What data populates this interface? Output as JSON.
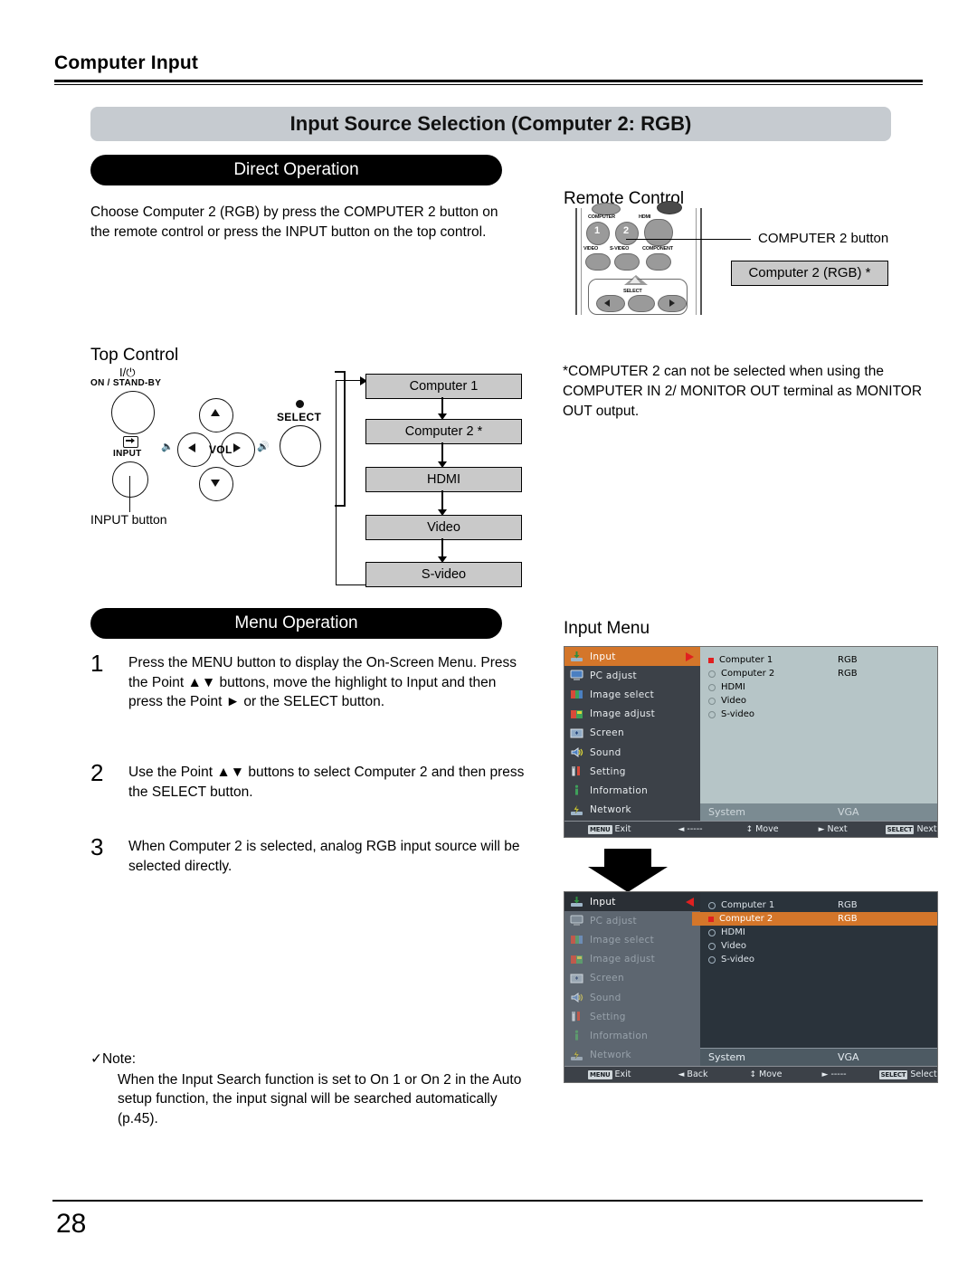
{
  "header": {
    "running_title": "Computer Input",
    "section_title": "Input Source Selection (Computer 2: RGB)"
  },
  "direct_operation": {
    "bar_label": "Direct Operation",
    "paragraph": "Choose Computer 2 (RGB) by press the COMPUTER 2 button on the remote control or press the INPUT button on the top control."
  },
  "remote": {
    "heading": "Remote Control",
    "callout": "COMPUTER 2 button",
    "highlight_box": "Computer 2 (RGB)  *",
    "buttons": {
      "computer": "COMPUTER",
      "hdmi": "HDMI",
      "one": "1",
      "two": "2",
      "video": "VIDEO",
      "svideo": "S-VIDEO",
      "component": "COMPONENT",
      "select": "SELECT"
    }
  },
  "footnote_star": "*COMPUTER 2 can not be selected when using the COMPUTER IN 2/ MONITOR OUT terminal as MONITOR OUT output.",
  "top_control": {
    "heading": "Top Control",
    "power_symbol": "I/⏻",
    "power_label": "ON / STAND-BY",
    "input_label": "INPUT",
    "vol_label": "VOL",
    "select_label": "SELECT",
    "callout": "INPUT button"
  },
  "flow_chart": {
    "items": [
      "Computer 1",
      "Computer 2 *",
      "HDMI",
      "Video",
      "S-video"
    ]
  },
  "menu_operation": {
    "bar_label": "Menu Operation",
    "steps": [
      {
        "num": "1",
        "text": "Press the MENU button to display the On-Screen Menu. Press the Point ▲▼ buttons, move the highlight to Input  and then press the Point ► or the SELECT button."
      },
      {
        "num": "2",
        "text": "Use the Point ▲▼ buttons to select Computer 2 and then press the SELECT button."
      },
      {
        "num": "3",
        "text": "When Computer 2 is selected, analog RGB input source will be selected directly."
      }
    ]
  },
  "note": {
    "heading": "✓Note:",
    "body": "When the Input Search function is set to On 1 or On 2 in the Auto setup function, the input signal will be searched automatically (p.45)."
  },
  "input_menu": {
    "heading": "Input Menu",
    "sidebar": [
      {
        "label": "Input",
        "icon": "input-icon"
      },
      {
        "label": "PC adjust",
        "icon": "monitor-icon"
      },
      {
        "label": "Image select",
        "icon": "image-select-icon"
      },
      {
        "label": "Image adjust",
        "icon": "image-adjust-icon"
      },
      {
        "label": "Screen",
        "icon": "screen-icon"
      },
      {
        "label": "Sound",
        "icon": "speaker-icon"
      },
      {
        "label": "Setting",
        "icon": "tools-icon"
      },
      {
        "label": "Information",
        "icon": "info-icon"
      },
      {
        "label": "Network",
        "icon": "network-icon"
      }
    ],
    "sources": [
      {
        "label": "Computer 1",
        "value": "RGB"
      },
      {
        "label": "Computer 2",
        "value": "RGB"
      },
      {
        "label": "HDMI",
        "value": ""
      },
      {
        "label": "Video",
        "value": ""
      },
      {
        "label": "S-video",
        "value": ""
      }
    ],
    "system_row": {
      "label": "System",
      "value": "VGA"
    },
    "screen1": {
      "selected_sidebar": "Input",
      "selected_source": "Computer 1",
      "footer": [
        {
          "key": "MENU",
          "label": "Exit"
        },
        {
          "glyph": "◄",
          "label": "-----"
        },
        {
          "glyph": "↕",
          "label": "Move"
        },
        {
          "glyph": "►",
          "label": "Next"
        },
        {
          "key": "SELECT",
          "label": "Next"
        }
      ]
    },
    "screen2": {
      "selected_sidebar": "Input",
      "selected_source": "Computer 2",
      "footer": [
        {
          "key": "MENU",
          "label": "Exit"
        },
        {
          "glyph": "◄",
          "label": "Back"
        },
        {
          "glyph": "↕",
          "label": "Move"
        },
        {
          "glyph": "►",
          "label": "-----"
        },
        {
          "key": "SELECT",
          "label": "Select"
        }
      ]
    }
  },
  "page_number": "28",
  "colors": {
    "section_bar": "#c6cbd0",
    "osd_sidebar": "#3c4148",
    "osd_panel_light": "#b6c5c7",
    "osd_panel_dark": "#2a333b",
    "highlight_orange": "#d4762a",
    "accent_red": "#e02020"
  }
}
